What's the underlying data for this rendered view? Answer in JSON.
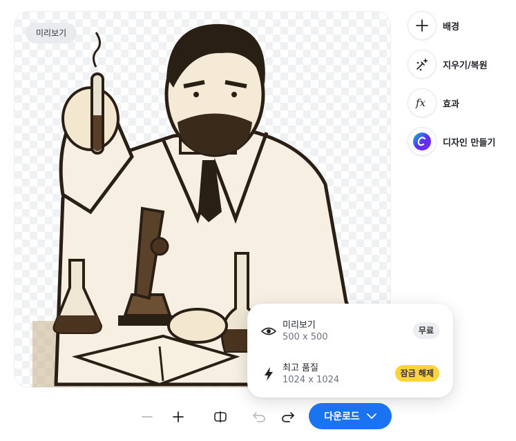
{
  "preview": {
    "badge": "미리보기",
    "image_subject": "scientist-with-test-tube-and-microscope"
  },
  "tools": [
    {
      "label": "배경",
      "icon": "plus-icon"
    },
    {
      "label": "지우기/복원",
      "icon": "magic-eraser-icon"
    },
    {
      "label": "효과",
      "icon": "fx-icon"
    },
    {
      "label": "디자인 만들기",
      "icon": "canva-logo-icon"
    }
  ],
  "download_menu": {
    "options": [
      {
        "title": "미리보기",
        "size": "500 x 500",
        "badge": "무료",
        "icon": "eye-icon"
      },
      {
        "title": "최고 품질",
        "size": "1024 x 1024",
        "badge": "잠금 해제",
        "icon": "lightning-icon"
      }
    ]
  },
  "toolbar": {
    "download_label": "다운로드"
  },
  "colors": {
    "primary": "#1a73f0",
    "unlock_badge": "#ffd43b",
    "free_badge": "#eceef1",
    "ink": "#2a1f14"
  }
}
